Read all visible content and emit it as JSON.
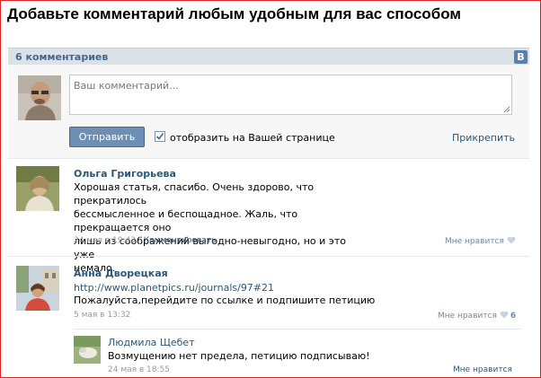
{
  "page": {
    "title": "Добавьте комментарий любым удобным для вас способом"
  },
  "bar": {
    "count_label": "6 комментариев",
    "logo": "В"
  },
  "form": {
    "placeholder": "Ваш комментарий...",
    "send_label": "Отправить",
    "checkbox_label": "отобразить на Вашей странице",
    "checkbox_checked": true,
    "attach_label": "Прикрепить"
  },
  "comments": [
    {
      "name": "Ольга Григорьева",
      "lines": [
        "Хорошая статья, спасибо. Очень здорово, что прекратилось",
        "бессмысленное и беспощадное. Жаль, что прекращается оно",
        "лишь из соображений выгодно-невыгодно, но и это уже",
        "немало."
      ],
      "date": "24 мая в 19:43",
      "reply_label": "Комментировать",
      "like_label": "Мне нравится"
    },
    {
      "name": "Анна Дворецкая",
      "link": "http://www.planetpics.ru/journals/97#21",
      "text": "Пожалуйста,перейдите по ссылке и подпишите петицию",
      "date": "5 мая в 13:32",
      "like_label": "Мне нравится",
      "like_count": "6"
    }
  ],
  "reply": {
    "name": "Людмила Щебет",
    "text": "Возмущению нет предела, петицию подписываю!",
    "date": "24 мая в 18:55",
    "like_label": "Мне нравится"
  },
  "icons": {
    "heart": "heart-icon",
    "check": "check-icon",
    "resize": "resize-handle-icon"
  },
  "colors": {
    "link": "#2b587a",
    "button": "#6d8fb3",
    "bar": "#dae2e8",
    "frame": "#dd2222"
  }
}
